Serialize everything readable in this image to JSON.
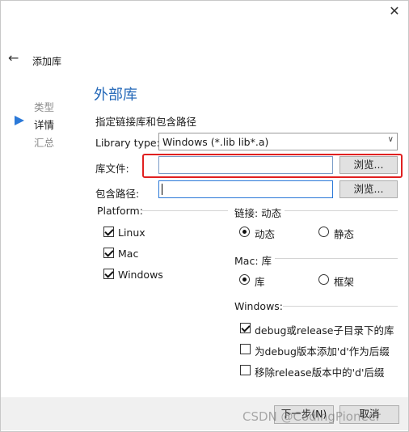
{
  "dialog": {
    "title": "添加库"
  },
  "steps": [
    {
      "label": "类型",
      "active": false
    },
    {
      "label": "详情",
      "active": true
    },
    {
      "label": "汇总",
      "active": false
    }
  ],
  "section": {
    "title": "外部库",
    "subtitle": "指定链接库和包含路径"
  },
  "form": {
    "library_type_label": "Library type:",
    "library_type_value": "Windows (*.lib lib*.a)",
    "library_file_label": "库文件:",
    "library_file_value": "",
    "include_path_label": "包含路径:",
    "include_path_value": "",
    "browse_label": "浏览..."
  },
  "platform": {
    "title": "Platform:",
    "options": [
      {
        "label": "Linux",
        "checked": true
      },
      {
        "label": "Mac",
        "checked": true
      },
      {
        "label": "Windows",
        "checked": true
      }
    ]
  },
  "linkage": {
    "title": "链接: 动态",
    "options": [
      {
        "label": "动态",
        "selected": true
      },
      {
        "label": "静态",
        "selected": false
      }
    ]
  },
  "mac": {
    "title": "Mac: 库",
    "options": [
      {
        "label": "库",
        "selected": true
      },
      {
        "label": "框架",
        "selected": false
      }
    ]
  },
  "windows": {
    "title": "Windows:",
    "options": [
      {
        "label": "debug或release子目录下的库",
        "checked": true
      },
      {
        "label": "为debug版本添加'd'作为后缀",
        "checked": false
      },
      {
        "label": "移除release版本中的'd'后缀",
        "checked": false
      }
    ]
  },
  "footer": {
    "finish_label": "下一步(N)",
    "cancel_label": "取消"
  },
  "watermark": "CSDN @CodingPioneer",
  "colors": {
    "accent": "#2b79d8",
    "section_title": "#2468b8",
    "highlight": "#e02020"
  }
}
